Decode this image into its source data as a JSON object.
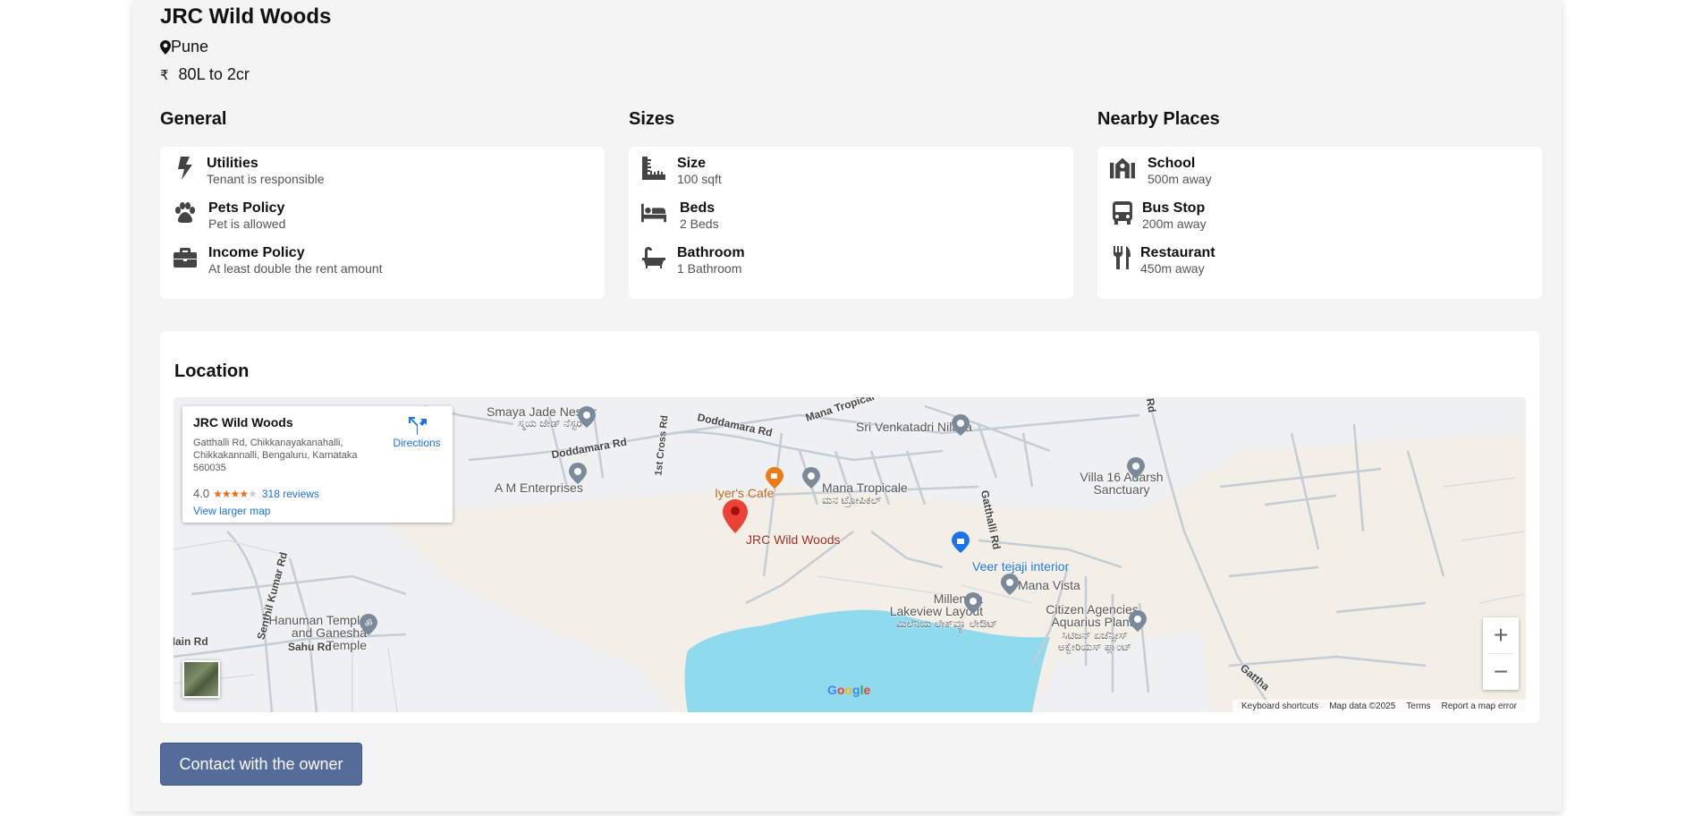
{
  "property": {
    "title": "JRC Wild Woods",
    "location": "Pune",
    "currency_symbol": "₹",
    "price": "80L to 2cr"
  },
  "general": {
    "heading": "General",
    "items": [
      {
        "icon": "bolt-icon",
        "title": "Utilities",
        "sub": "Tenant is responsible"
      },
      {
        "icon": "paw-icon",
        "title": "Pets Policy",
        "sub": "Pet is allowed"
      },
      {
        "icon": "briefcase-icon",
        "title": "Income Policy",
        "sub": "At least double the rent amount"
      }
    ]
  },
  "sizes": {
    "heading": "Sizes",
    "items": [
      {
        "icon": "ruler-icon",
        "title": "Size",
        "sub": "100 sqft"
      },
      {
        "icon": "bed-icon",
        "title": "Beds",
        "sub": "2 Beds"
      },
      {
        "icon": "bath-icon",
        "title": "Bathroom",
        "sub": "1 Bathroom"
      }
    ]
  },
  "nearby": {
    "heading": "Nearby Places",
    "items": [
      {
        "icon": "school-icon",
        "title": "School",
        "sub": "500m away"
      },
      {
        "icon": "bus-icon",
        "title": "Bus Stop",
        "sub": "200m away"
      },
      {
        "icon": "utensils-icon",
        "title": "Restaurant",
        "sub": "450m away"
      }
    ]
  },
  "location": {
    "heading": "Location",
    "map": {
      "info": {
        "title": "JRC Wild Woods",
        "address": "Gatthalli Rd, Chikkanayakanahalli, Chikkakannalli, Bengaluru, Karnataka 560035",
        "rating": "4.0",
        "reviews": "318 reviews",
        "larger_map": "View larger map",
        "directions": "Directions"
      },
      "labels": {
        "smaya": "Smaya Jade Nester",
        "smaya_kn": "ಸ್ಮಯ ಜೇಡ್ ನೆಸ್ಟರ್",
        "doddamara1": "Doddamara Rd",
        "doddamara2": "Doddamara Rd",
        "mana_tropicale_rd": "Mana Tropical",
        "sri_venkatadri": "Sri Venkatadri Nilaya",
        "rd_top": "Rd",
        "first_cross": "1st Cross Rd",
        "am_enterprises": "A M Enterprises",
        "iyers_cafe": "Iyer's Cafe",
        "mana_tropicale": "Mana Tropicale",
        "mana_tropicale_kn": "ಮನ ಟ್ರೋಪಿಕಲ್",
        "villa16": "Villa 16 Adarsh Sanctuary",
        "jrc_pin": "JRC Wild Woods",
        "veer_tejaji": "Veer tejaji interior",
        "gatthalli_rd": "Gatthalli Rd",
        "mana_vista": "Mana Vista",
        "millennia": "Millennia Lakeview Layout",
        "millennia_kn": "ಮಿಲೆನಿಯ ಲೇಕ್‌ವ್ಯೂ ಲೇಔಟ್",
        "citizen": "Citizen Agencies Aquarius Plant",
        "citizen_kn": "ಸಿಟಿಜನ್ ಏಜೆನ್ಸೀಸ್ ಅಕ್ವೇರಿಯಸ್ ಪ್ಲಾಂಟ್",
        "senthil": "Senthil Kumar Rd",
        "hanuman": "Hanuman Temple and Ganesha Temple",
        "sahu": "Sahu Rd",
        "main_rd": "Main Rd",
        "gatthalli_bottom": "Gattha",
        "rd_left": "Rd"
      },
      "google": "Google",
      "attribution": [
        "Keyboard shortcuts",
        "Map data ©2025",
        "Terms",
        "Report a map error"
      ],
      "zoom_in": "+",
      "zoom_out": "−"
    }
  },
  "cta": {
    "label": "Contact with the owner"
  },
  "colors": {
    "button": "#556b9a",
    "pin": "#ea4335",
    "water": "#90daee",
    "land": "#f3efe6"
  }
}
